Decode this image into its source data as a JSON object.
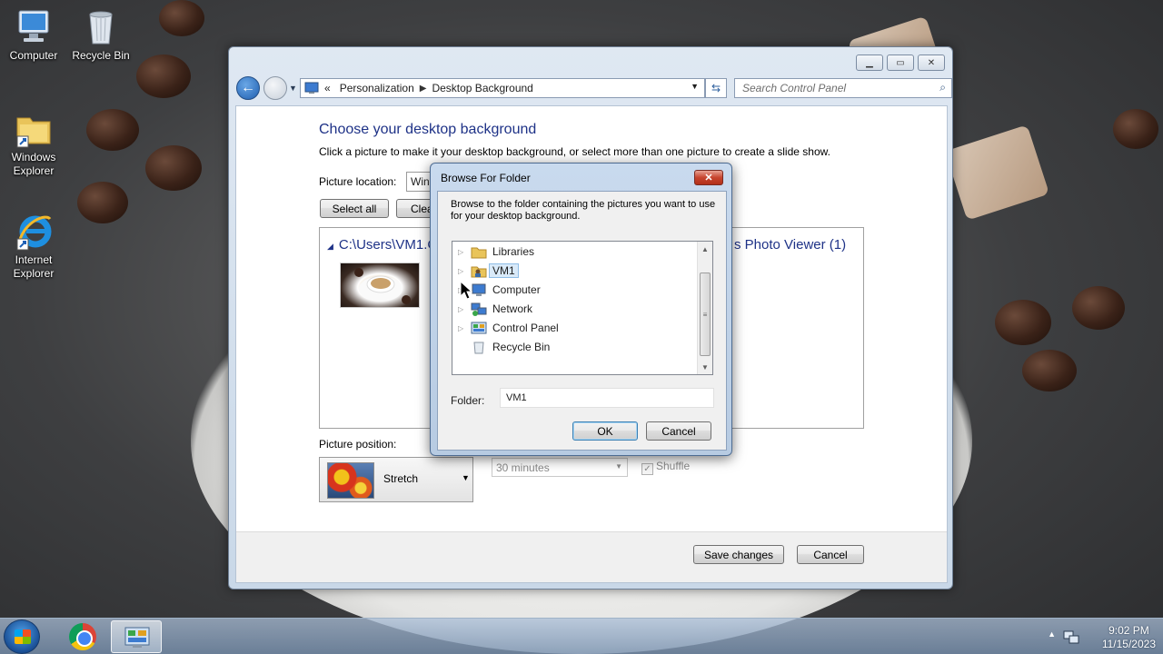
{
  "desktop": {
    "icons": [
      {
        "label": "Computer",
        "icon": "computer-icon"
      },
      {
        "label": "Recycle Bin",
        "icon": "recycle-bin-icon"
      },
      {
        "label": "Windows Explorer",
        "icon": "folder-icon"
      },
      {
        "label": "Internet Explorer",
        "icon": "ie-icon"
      }
    ]
  },
  "window": {
    "breadcrumb": {
      "prefix": "«",
      "items": [
        "Personalization",
        "Desktop Background"
      ]
    },
    "search_placeholder": "Search Control Panel",
    "heading": "Choose your desktop background",
    "subheading": "Click a picture to make it your desktop background, or select more than one picture to create a slide show.",
    "picture_location_label": "Picture location:",
    "picture_location_value": "Windows Desktop Backgrounds",
    "select_all": "Select all",
    "clear_all": "Clear all",
    "group_path": "C:\\Users\\VM1.C",
    "group_right": "s Photo Viewer (1)",
    "picture_position_label": "Picture position:",
    "picture_position_value": "Stretch",
    "interval_value": "30 minutes",
    "shuffle_label": "Shuffle",
    "save_changes": "Save changes",
    "cancel": "Cancel"
  },
  "dialog": {
    "title": "Browse For Folder",
    "close_glyph": "✕",
    "description": "Browse to the folder containing the pictures you want to use for your desktop background.",
    "tree": [
      {
        "label": "Libraries",
        "icon": "libraries-icon",
        "expandable": true,
        "selected": false
      },
      {
        "label": "VM1",
        "icon": "user-folder-icon",
        "expandable": true,
        "selected": true
      },
      {
        "label": "Computer",
        "icon": "computer-icon",
        "expandable": true,
        "selected": false
      },
      {
        "label": "Network",
        "icon": "network-icon",
        "expandable": true,
        "selected": false
      },
      {
        "label": "Control Panel",
        "icon": "control-panel-icon",
        "expandable": true,
        "selected": false
      },
      {
        "label": "Recycle Bin",
        "icon": "recycle-bin-icon",
        "expandable": false,
        "selected": false
      }
    ],
    "folder_label": "Folder:",
    "folder_value": "VM1",
    "ok": "OK",
    "cancel": "Cancel"
  },
  "taskbar": {
    "time": "9:02 PM",
    "date": "11/15/2023"
  }
}
